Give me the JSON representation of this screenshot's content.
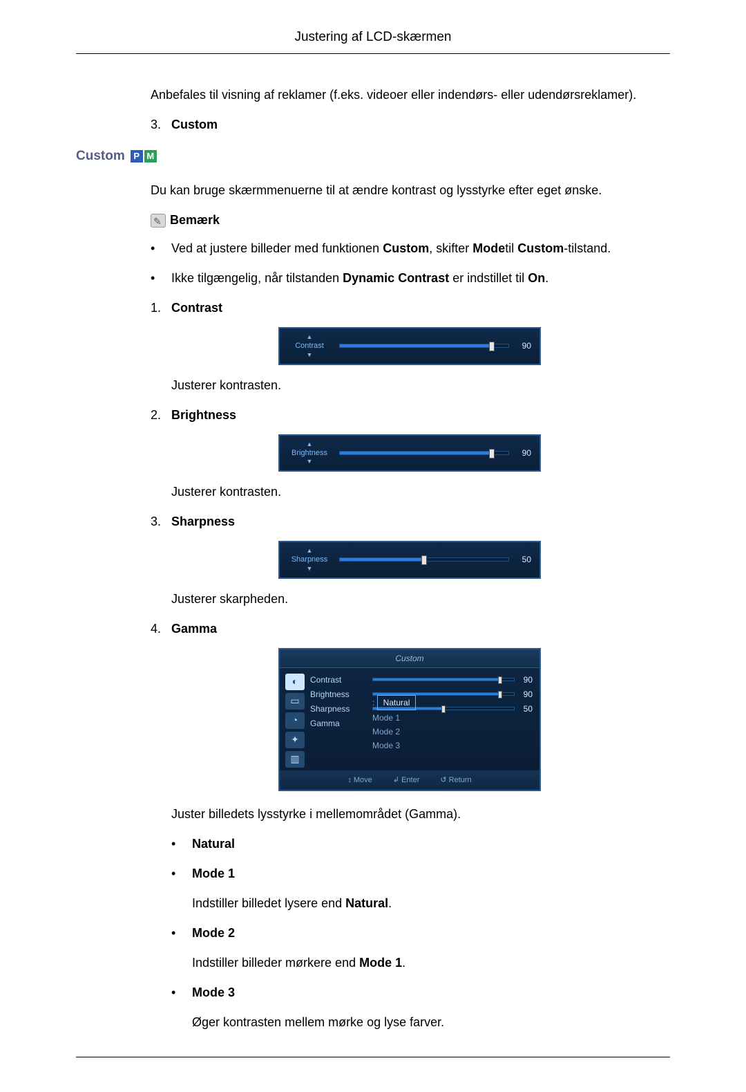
{
  "header": {
    "title": "Justering af LCD-skærmen"
  },
  "intro_para": "Anbefales til visning af reklamer (f.eks. videoer eller indendørs- eller udendørsreklamer).",
  "intro_item": {
    "num": "3.",
    "label": "Custom"
  },
  "section_heading": "Custom",
  "badge": {
    "p": "P",
    "m": "M"
  },
  "custom_desc": "Du kan bruge skærmmenuerne til at ændre kontrast og lysstyrke efter eget ønske.",
  "note_label": "Bemærk",
  "notes": [
    {
      "pre": "Ved at justere billeder med funktionen ",
      "b1": "Custom",
      "mid": ", skifter ",
      "b2": "Mode",
      "mid2": "til ",
      "b3": "Custom",
      "post": "-tilstand."
    },
    {
      "pre": "Ikke tilgængelig, når tilstanden ",
      "b1": "Dynamic Contrast",
      "mid": " er indstillet til ",
      "b2": "On",
      "post": "."
    }
  ],
  "items": [
    {
      "num": "1.",
      "title": "Contrast",
      "osd": {
        "label": "Contrast",
        "value": 90
      },
      "desc": "Justerer kontrasten."
    },
    {
      "num": "2.",
      "title": "Brightness",
      "osd": {
        "label": "Brightness",
        "value": 90
      },
      "desc": "Justerer kontrasten."
    },
    {
      "num": "3.",
      "title": "Sharpness",
      "osd": {
        "label": "Sharpness",
        "value": 50
      },
      "desc": "Justerer skarpheden."
    },
    {
      "num": "4.",
      "title": "Gamma",
      "desc": "Juster billedets lysstyrke i mellemområdet (Gamma)."
    }
  ],
  "gamma_menu": {
    "title": "Custom",
    "rows": [
      {
        "label": "Contrast",
        "value": 90
      },
      {
        "label": "Brightness",
        "value": 90
      },
      {
        "label": "Sharpness",
        "value": 50
      }
    ],
    "gamma_label": "Gamma",
    "gamma_selected": "Natural",
    "gamma_options": [
      "Mode 1",
      "Mode 2",
      "Mode 3"
    ],
    "footer": {
      "move": "Move",
      "enter": "Enter",
      "ret": "Return"
    },
    "footer_glyph": {
      "move": "↕",
      "enter": "↲",
      "ret": "↺"
    }
  },
  "gamma_sub": [
    {
      "title": "Natural",
      "desc": ""
    },
    {
      "title": "Mode 1",
      "desc_pre": "Indstiller billedet lysere end ",
      "desc_bold": "Natural",
      "desc_post": "."
    },
    {
      "title": "Mode 2",
      "desc_pre": "Indstiller billeder mørkere end ",
      "desc_bold": "Mode 1",
      "desc_post": "."
    },
    {
      "title": "Mode 3",
      "desc_pre": "Øger kontrasten mellem mørke og lyse farver.",
      "desc_bold": "",
      "desc_post": ""
    }
  ]
}
